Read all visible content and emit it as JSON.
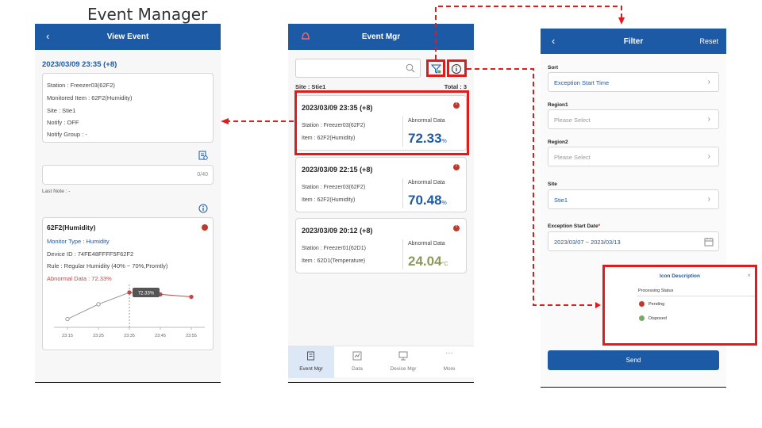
{
  "page_title": "Event Manager",
  "view_event": {
    "back": "‹",
    "title": "View Event",
    "date": "2023/03/09 23:35 (+8)",
    "info": [
      "Station : Freezer03(62F2)",
      "Monitored Item : 62F2(Humidity)",
      "Site : Stie1",
      "Notify : OFF",
      "Notify Group : -"
    ],
    "note_counter": "0/40",
    "last_note": "Last Note : -",
    "chart_card": {
      "title": "62F2(Humidity)",
      "monitor_type": "Monitor Type : Humidity",
      "device_id": "Device ID : 74FE48FFFF5F62F2",
      "rule": "Rule : Regular Humidity (40% ~ 70%,Promtly)",
      "abnormal": "Abnormal Data : 72.33%"
    }
  },
  "chart_data": {
    "type": "line",
    "x": [
      "23:15",
      "23:25",
      "23:35",
      "23:45",
      "23:55"
    ],
    "values": [
      40,
      58,
      72.33,
      70,
      67
    ],
    "highlight_label": "72.33%",
    "highlight_index": 2,
    "colors": {
      "normal": "#999999",
      "abnormal": "#c04848"
    }
  },
  "event_mgr": {
    "title": "Event Mgr",
    "site": "Site : Stie1",
    "total": "Total : 3",
    "events": [
      {
        "date": "2023/03/09 23:35 (+8)",
        "station": "Station : Freezer03(62F2)",
        "item": "Item : 62F2(Humidity)",
        "label": "Abnormal Data",
        "value": "72.33",
        "unit": "%",
        "color": "#1c5aa6"
      },
      {
        "date": "2023/03/09 22:15 (+8)",
        "station": "Station : Freezer03(62F2)",
        "item": "Item : 62F2(Humidity)",
        "label": "Abnormal Data",
        "value": "70.48",
        "unit": "%",
        "color": "#1c5aa6"
      },
      {
        "date": "2023/03/09 20:12 (+8)",
        "station": "Station : Freezer01(62D1)",
        "item": "Item : 62D1(Temperature)",
        "label": "Abnormal Data",
        "value": "24.04",
        "unit": "°C",
        "color": "#8a9a5b"
      }
    ],
    "tabs": [
      "Event Mgr",
      "Data",
      "Device Mgr",
      "More"
    ]
  },
  "filter": {
    "back": "‹",
    "title": "Filter",
    "reset": "Reset",
    "fields": [
      {
        "label": "Sort",
        "value": "Exception Start Time",
        "placeholder": false
      },
      {
        "label": "Region1",
        "value": "Please Select",
        "placeholder": true
      },
      {
        "label": "Region2",
        "value": "Please Select",
        "placeholder": true
      },
      {
        "label": "Site",
        "value": "Stie1",
        "placeholder": false
      }
    ],
    "date_label": "Exception Start Date",
    "date_required": "*",
    "date_value": "2023/03/07 ~ 2023/03/13",
    "send": "Send"
  },
  "icon_description": {
    "title": "Icon Description",
    "close": "×",
    "section": "Processing Status",
    "pending": "Pending",
    "disposed": "Disposed"
  }
}
